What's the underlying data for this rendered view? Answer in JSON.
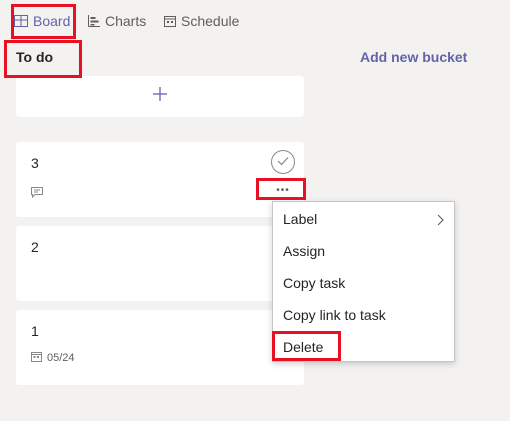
{
  "tabs": [
    {
      "label": "Board",
      "icon": "board-icon",
      "active": true
    },
    {
      "label": "Charts",
      "icon": "charts-icon",
      "active": false
    },
    {
      "label": "Schedule",
      "icon": "schedule-icon",
      "active": false
    }
  ],
  "bucket": {
    "title": "To do",
    "add_task_icon": "plus-icon"
  },
  "add_bucket_label": "Add new bucket",
  "tasks": [
    {
      "title": "3",
      "icons": [
        "check-circle-icon",
        "comment-icon",
        "more-icon"
      ],
      "more_label": "•••"
    },
    {
      "title": "2"
    },
    {
      "title": "1",
      "due_date": "05/24",
      "due_icon": "calendar-icon"
    }
  ],
  "context_menu": {
    "items": [
      {
        "label": "Label",
        "has_submenu": true
      },
      {
        "label": "Assign"
      },
      {
        "label": "Copy task"
      },
      {
        "label": "Copy link to task"
      },
      {
        "label": "Delete"
      }
    ]
  },
  "colors": {
    "accent": "#6264a7",
    "highlight": "#e81123",
    "background": "#f3f2f1",
    "card": "#ffffff"
  }
}
